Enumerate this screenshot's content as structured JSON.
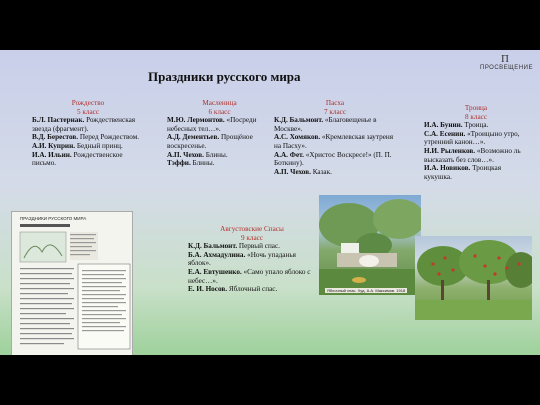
{
  "slide": {
    "title": "Праздники русского мира",
    "logo_text": "ПРОСВЕЩЕНИЕ",
    "logo_mark": "П"
  },
  "columns": [
    {
      "heading": "Рождество",
      "grade": "5 класс",
      "items": [
        {
          "author": "Б.Л. Пастернак.",
          "work": "Рождественская звезда (фрагмент)."
        },
        {
          "author": "В.Д. Берестов.",
          "work": "Перед Рождеством."
        },
        {
          "author": "А.И. Куприн.",
          "work": "Бедный принц."
        },
        {
          "author": "И.А. Ильин.",
          "work": "Рождественское письмо."
        }
      ]
    },
    {
      "heading": "Масленица",
      "grade": "6 класс",
      "items": [
        {
          "author": "М.Ю. Лермонтов.",
          "work": "«Посреди небесных тел…»."
        },
        {
          "author": "А.Д. Дементьев.",
          "work": "Прощёное воскресенье."
        },
        {
          "author": "А.П. Чехов.",
          "work": "Блины."
        },
        {
          "author": "Тэффи.",
          "work": "Блины."
        }
      ]
    },
    {
      "heading": "Пасха",
      "grade": "7 класс",
      "items": [
        {
          "author": "К.Д. Бальмонт.",
          "work": "«Благовещенье в Москве»."
        },
        {
          "author": "А.С. Хомяков.",
          "work": "«Кремлевская заутреня на Пасху»."
        },
        {
          "author": "А.А. Фет.",
          "work": "«Христос Воскресе!» (П. П. Боткину)."
        },
        {
          "author": "А.П. Чехов.",
          "work": "Казак."
        }
      ]
    },
    {
      "heading": "Троица",
      "grade": "8 класс",
      "items": [
        {
          "author": "И.А. Бунин.",
          "work": "Троица."
        },
        {
          "author": "С.А. Есенин.",
          "work": "«Троицыно утро, утренний канон…»."
        },
        {
          "author": "Н.И. Рыленков.",
          "work": "«Возможно ль высказать без слов…»."
        },
        {
          "author": "И.А. Новиков.",
          "work": "Троицкая кукушка."
        }
      ]
    },
    {
      "heading": "Августовские Спасы",
      "grade": "9 класс",
      "items": [
        {
          "author": "К.Д. Бальмонт.",
          "work": "Первый спас."
        },
        {
          "author": "Б.А. Ахмадулина.",
          "work": "«Ночь упаданья яблок»."
        },
        {
          "author": "Е.А. Евтушенко.",
          "work": "«Само упало яблоко с небес…»."
        },
        {
          "author": "Е. И. Носов.",
          "work": "Яблочный спас."
        }
      ]
    }
  ],
  "images": {
    "book_header": "ПРАЗДНИКИ РУССКОГО МИРА",
    "painting_caption": "Яблочный спас. Худ. А.А. Максимов. 1918"
  }
}
